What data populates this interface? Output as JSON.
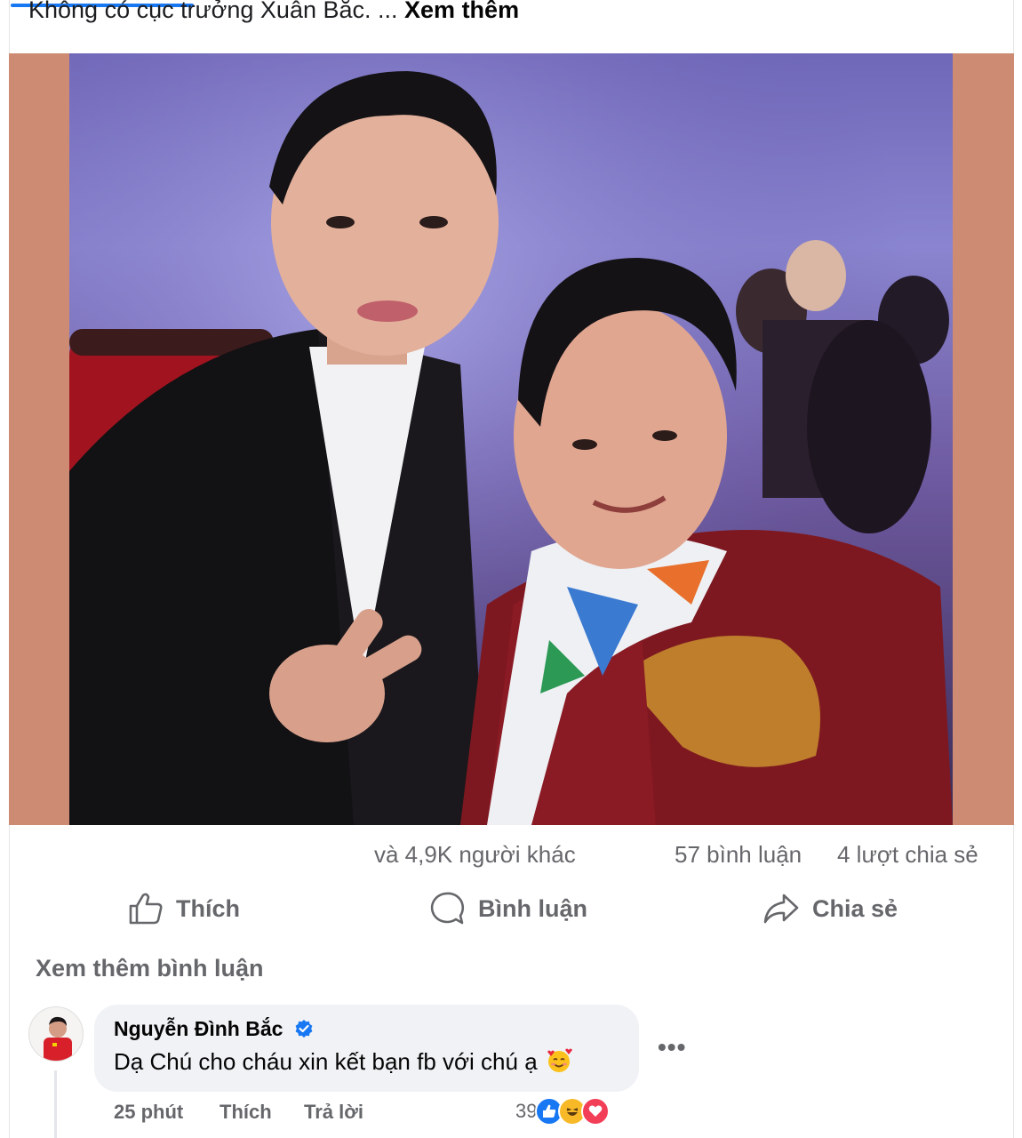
{
  "post": {
    "caption_text": "Không có cục trưởng Xuân Bắc. ...",
    "caption_more": "Xem thêm"
  },
  "stats": {
    "reactors": "và 4,9K người khác",
    "comments": "57 bình luận",
    "shares": "4 lượt chia sẻ"
  },
  "actions": {
    "like": "Thích",
    "comment": "Bình luận",
    "share": "Chia sẻ"
  },
  "comments_section": {
    "see_more": "Xem thêm bình luận"
  },
  "comment": {
    "author": "Nguyễn Đình Bắc",
    "text": "Dạ Chú cho cháu xin kết bạn fb với chú ạ",
    "time": "25 phút",
    "like_label": "Thích",
    "reply_label": "Trả lời",
    "reaction_count": "39",
    "more_icon": "more-horizontal-icon"
  },
  "colors": {
    "accent": "#1877f2",
    "photo_border": "#cd8b73",
    "secondary_text": "#65676b",
    "bubble": "#f0f2f5"
  }
}
